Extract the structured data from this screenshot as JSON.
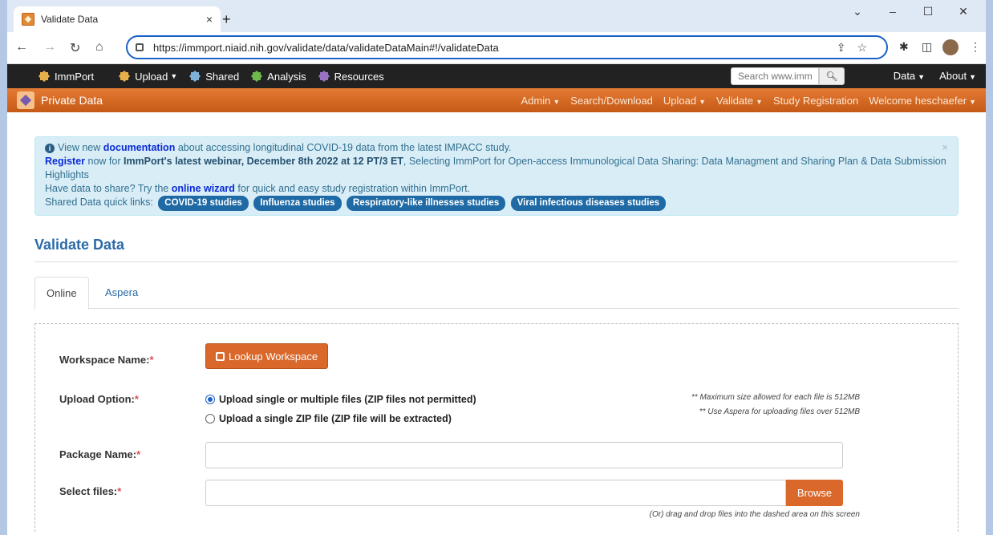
{
  "browser": {
    "tab_title": "Validate Data",
    "tab_close": "×",
    "new_tab": "+",
    "url": "https://immport.niaid.nih.gov/validate/data/validateDataMain#!/validateData",
    "window_controls": [
      "⌄",
      "–",
      "☐",
      "✕"
    ]
  },
  "immport_nav": {
    "brand": "ImmPort",
    "items": [
      {
        "label": "Upload",
        "dropdown": true,
        "color": "#e8b04a"
      },
      {
        "label": "Shared",
        "dropdown": false,
        "color": "#7fb2d9"
      },
      {
        "label": "Analysis",
        "dropdown": false,
        "color": "#6fb84d"
      },
      {
        "label": "Resources",
        "dropdown": false,
        "color": "#9a72c4"
      }
    ],
    "search_placeholder": "Search www.immpo",
    "data_label": "Data",
    "about_label": "About"
  },
  "private_nav": {
    "brand": "Private Data",
    "items": [
      "Admin",
      "Search/Download",
      "Upload",
      "Validate",
      "Study Registration",
      "Welcome heschaefer"
    ]
  },
  "alert": {
    "line1_pre": "View new ",
    "line1_link": "documentation",
    "line1_post": " about accessing longitudinal COVID-19 data from the latest IMPACC study.",
    "line2_link": "Register",
    "line2_mid": " now for ",
    "line2_bold": "ImmPort's latest webinar, December 8th 2022 at 12 PT/3 ET",
    "line2_post": ", Selecting ImmPort for Open-access Immunological Data Sharing: Data Managment and Sharing Plan & Data Submission Highlights",
    "line3_pre": "Have data to share? Try the ",
    "line3_link": "online wizard",
    "line3_post": " for quick and easy study registration within ImmPort.",
    "line4_pre": "Shared Data quick links:",
    "quick_links": [
      "COVID-19 studies",
      "Influenza studies",
      "Respiratory-like illnesses studies",
      "Viral infectious diseases studies"
    ],
    "close": "×"
  },
  "page": {
    "title": "Validate Data",
    "tabs": [
      "Online",
      "Aspera"
    ]
  },
  "form": {
    "workspace_label": "Workspace Name:",
    "lookup_button": "Lookup Workspace",
    "upload_option_label": "Upload Option:",
    "option_multi": "Upload single or multiple files (ZIP files not permitted)",
    "option_zip": "Upload a single ZIP file (ZIP file will be extracted)",
    "note1": "** Maximum size allowed for each file is 512MB",
    "note2": "** Use Aspera for uploading files over 512MB",
    "package_label": "Package Name:",
    "package_value": "",
    "select_files_label": "Select files:",
    "select_files_value": "",
    "browse_button": "Browse",
    "drag_note": "(Or) drag and drop files into the dashed area on this screen",
    "required_mark": "*"
  }
}
